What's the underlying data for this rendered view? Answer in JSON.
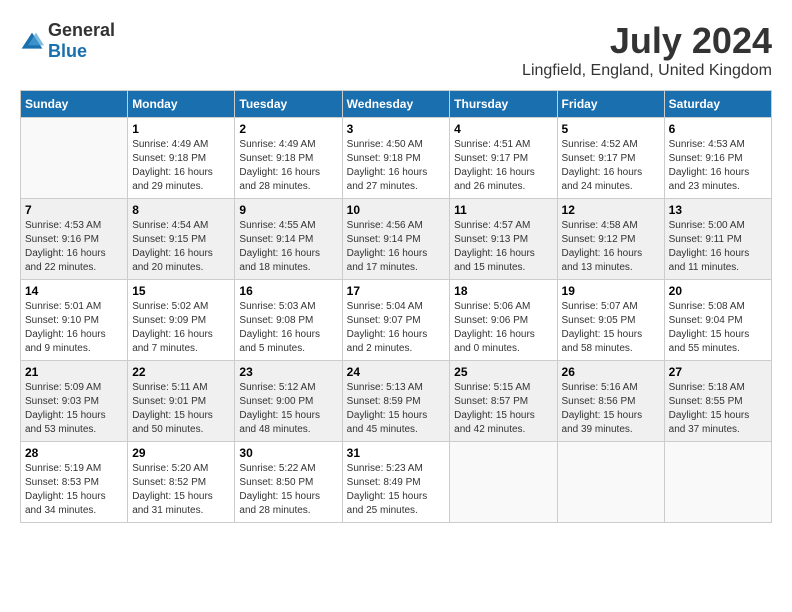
{
  "header": {
    "logo_general": "General",
    "logo_blue": "Blue",
    "month_year": "July 2024",
    "location": "Lingfield, England, United Kingdom"
  },
  "days_of_week": [
    "Sunday",
    "Monday",
    "Tuesday",
    "Wednesday",
    "Thursday",
    "Friday",
    "Saturday"
  ],
  "weeks": [
    [
      {
        "day": "",
        "sunrise": "",
        "sunset": "",
        "daylight": ""
      },
      {
        "day": "1",
        "sunrise": "Sunrise: 4:49 AM",
        "sunset": "Sunset: 9:18 PM",
        "daylight": "Daylight: 16 hours and 29 minutes."
      },
      {
        "day": "2",
        "sunrise": "Sunrise: 4:49 AM",
        "sunset": "Sunset: 9:18 PM",
        "daylight": "Daylight: 16 hours and 28 minutes."
      },
      {
        "day": "3",
        "sunrise": "Sunrise: 4:50 AM",
        "sunset": "Sunset: 9:18 PM",
        "daylight": "Daylight: 16 hours and 27 minutes."
      },
      {
        "day": "4",
        "sunrise": "Sunrise: 4:51 AM",
        "sunset": "Sunset: 9:17 PM",
        "daylight": "Daylight: 16 hours and 26 minutes."
      },
      {
        "day": "5",
        "sunrise": "Sunrise: 4:52 AM",
        "sunset": "Sunset: 9:17 PM",
        "daylight": "Daylight: 16 hours and 24 minutes."
      },
      {
        "day": "6",
        "sunrise": "Sunrise: 4:53 AM",
        "sunset": "Sunset: 9:16 PM",
        "daylight": "Daylight: 16 hours and 23 minutes."
      }
    ],
    [
      {
        "day": "7",
        "sunrise": "Sunrise: 4:53 AM",
        "sunset": "Sunset: 9:16 PM",
        "daylight": "Daylight: 16 hours and 22 minutes."
      },
      {
        "day": "8",
        "sunrise": "Sunrise: 4:54 AM",
        "sunset": "Sunset: 9:15 PM",
        "daylight": "Daylight: 16 hours and 20 minutes."
      },
      {
        "day": "9",
        "sunrise": "Sunrise: 4:55 AM",
        "sunset": "Sunset: 9:14 PM",
        "daylight": "Daylight: 16 hours and 18 minutes."
      },
      {
        "day": "10",
        "sunrise": "Sunrise: 4:56 AM",
        "sunset": "Sunset: 9:14 PM",
        "daylight": "Daylight: 16 hours and 17 minutes."
      },
      {
        "day": "11",
        "sunrise": "Sunrise: 4:57 AM",
        "sunset": "Sunset: 9:13 PM",
        "daylight": "Daylight: 16 hours and 15 minutes."
      },
      {
        "day": "12",
        "sunrise": "Sunrise: 4:58 AM",
        "sunset": "Sunset: 9:12 PM",
        "daylight": "Daylight: 16 hours and 13 minutes."
      },
      {
        "day": "13",
        "sunrise": "Sunrise: 5:00 AM",
        "sunset": "Sunset: 9:11 PM",
        "daylight": "Daylight: 16 hours and 11 minutes."
      }
    ],
    [
      {
        "day": "14",
        "sunrise": "Sunrise: 5:01 AM",
        "sunset": "Sunset: 9:10 PM",
        "daylight": "Daylight: 16 hours and 9 minutes."
      },
      {
        "day": "15",
        "sunrise": "Sunrise: 5:02 AM",
        "sunset": "Sunset: 9:09 PM",
        "daylight": "Daylight: 16 hours and 7 minutes."
      },
      {
        "day": "16",
        "sunrise": "Sunrise: 5:03 AM",
        "sunset": "Sunset: 9:08 PM",
        "daylight": "Daylight: 16 hours and 5 minutes."
      },
      {
        "day": "17",
        "sunrise": "Sunrise: 5:04 AM",
        "sunset": "Sunset: 9:07 PM",
        "daylight": "Daylight: 16 hours and 2 minutes."
      },
      {
        "day": "18",
        "sunrise": "Sunrise: 5:06 AM",
        "sunset": "Sunset: 9:06 PM",
        "daylight": "Daylight: 16 hours and 0 minutes."
      },
      {
        "day": "19",
        "sunrise": "Sunrise: 5:07 AM",
        "sunset": "Sunset: 9:05 PM",
        "daylight": "Daylight: 15 hours and 58 minutes."
      },
      {
        "day": "20",
        "sunrise": "Sunrise: 5:08 AM",
        "sunset": "Sunset: 9:04 PM",
        "daylight": "Daylight: 15 hours and 55 minutes."
      }
    ],
    [
      {
        "day": "21",
        "sunrise": "Sunrise: 5:09 AM",
        "sunset": "Sunset: 9:03 PM",
        "daylight": "Daylight: 15 hours and 53 minutes."
      },
      {
        "day": "22",
        "sunrise": "Sunrise: 5:11 AM",
        "sunset": "Sunset: 9:01 PM",
        "daylight": "Daylight: 15 hours and 50 minutes."
      },
      {
        "day": "23",
        "sunrise": "Sunrise: 5:12 AM",
        "sunset": "Sunset: 9:00 PM",
        "daylight": "Daylight: 15 hours and 48 minutes."
      },
      {
        "day": "24",
        "sunrise": "Sunrise: 5:13 AM",
        "sunset": "Sunset: 8:59 PM",
        "daylight": "Daylight: 15 hours and 45 minutes."
      },
      {
        "day": "25",
        "sunrise": "Sunrise: 5:15 AM",
        "sunset": "Sunset: 8:57 PM",
        "daylight": "Daylight: 15 hours and 42 minutes."
      },
      {
        "day": "26",
        "sunrise": "Sunrise: 5:16 AM",
        "sunset": "Sunset: 8:56 PM",
        "daylight": "Daylight: 15 hours and 39 minutes."
      },
      {
        "day": "27",
        "sunrise": "Sunrise: 5:18 AM",
        "sunset": "Sunset: 8:55 PM",
        "daylight": "Daylight: 15 hours and 37 minutes."
      }
    ],
    [
      {
        "day": "28",
        "sunrise": "Sunrise: 5:19 AM",
        "sunset": "Sunset: 8:53 PM",
        "daylight": "Daylight: 15 hours and 34 minutes."
      },
      {
        "day": "29",
        "sunrise": "Sunrise: 5:20 AM",
        "sunset": "Sunset: 8:52 PM",
        "daylight": "Daylight: 15 hours and 31 minutes."
      },
      {
        "day": "30",
        "sunrise": "Sunrise: 5:22 AM",
        "sunset": "Sunset: 8:50 PM",
        "daylight": "Daylight: 15 hours and 28 minutes."
      },
      {
        "day": "31",
        "sunrise": "Sunrise: 5:23 AM",
        "sunset": "Sunset: 8:49 PM",
        "daylight": "Daylight: 15 hours and 25 minutes."
      },
      {
        "day": "",
        "sunrise": "",
        "sunset": "",
        "daylight": ""
      },
      {
        "day": "",
        "sunrise": "",
        "sunset": "",
        "daylight": ""
      },
      {
        "day": "",
        "sunrise": "",
        "sunset": "",
        "daylight": ""
      }
    ]
  ]
}
